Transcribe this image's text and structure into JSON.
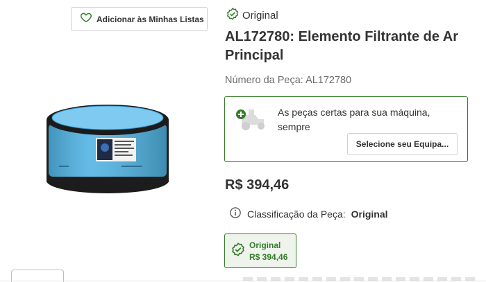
{
  "wishlist": {
    "label": "Adicionar às Minhas Listas",
    "icon": "heart-icon"
  },
  "badge": {
    "label": "Original",
    "icon": "check-badge-icon"
  },
  "product": {
    "title": "AL172780: Elemento Filtrante de Ar Principal",
    "part_number": "Número da Peça: AL172780",
    "price": "R$ 394,46",
    "image": "air-filter-element-image"
  },
  "fitment": {
    "message": "As peças certas para sua máquina, sempre",
    "select_label": "Selecione seu Equipa...",
    "icon": "mower-add-icon"
  },
  "classification": {
    "label": "Classificação da Peça:",
    "value": "Original",
    "icon": "info-icon"
  },
  "option": {
    "label": "Original",
    "price": "R$ 394,46",
    "icon": "check-badge-icon"
  },
  "colors": {
    "accent": "#367c2b",
    "filter_blue": "#4fb3e3"
  }
}
